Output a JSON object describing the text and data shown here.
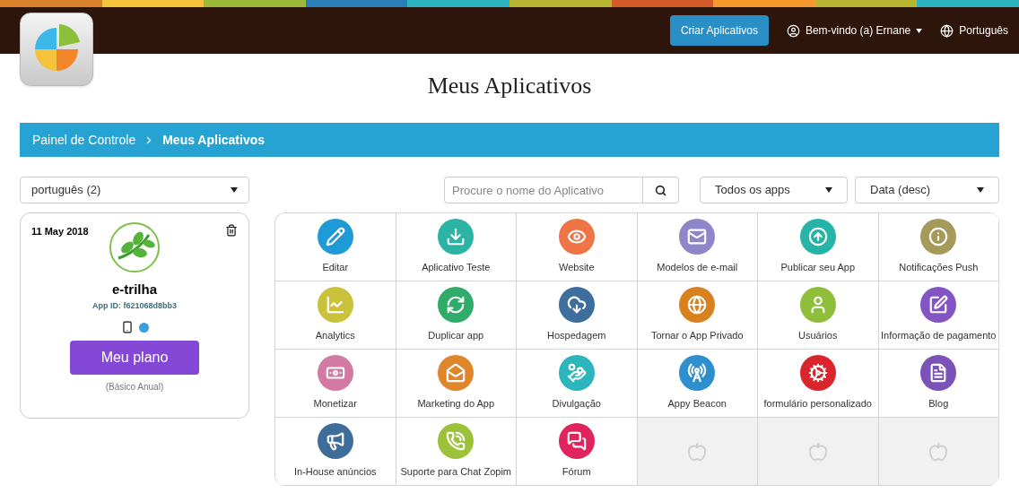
{
  "topbar": {
    "create_button": "Criar Aplicativos",
    "user_menu": "Bem-vindo (a) Ernane",
    "language": "Português"
  },
  "title": "Meus Aplicativos",
  "breadcrumb": [
    "Painel de Controle",
    "Meus Aplicativos"
  ],
  "filters": {
    "language_select": "português (2)",
    "search": {
      "placeholder": "Procure o nome do Aplicativo"
    },
    "type_select": "Todos os apps",
    "sort_select": "Data (desc)"
  },
  "app_card": {
    "date": "11 May 2018",
    "name": "e-trilha",
    "app_id": "App ID: f621068d8bb3",
    "plan_button": "Meu plano",
    "plan_note": "(Básico Anual)"
  },
  "tiles": [
    {
      "kind": "feature",
      "label": "Editar",
      "color": "#1e9ad6"
    },
    {
      "kind": "feature",
      "label": "Aplicativo Teste",
      "color": "#2bb3a3"
    },
    {
      "kind": "feature",
      "label": "Website",
      "color": "#ef7446"
    },
    {
      "kind": "feature",
      "label": "Modelos de e-mail",
      "color": "#8e86c9"
    },
    {
      "kind": "feature",
      "label": "Publicar seu App",
      "color": "#27b4a8"
    },
    {
      "kind": "feature",
      "label": "Notificações Push",
      "color": "#a59a5a"
    },
    {
      "kind": "feature",
      "label": "Analytics",
      "color": "#c9c23a"
    },
    {
      "kind": "feature",
      "label": "Duplicar app",
      "color": "#2fab6a"
    },
    {
      "kind": "feature",
      "label": "Hospedagem",
      "color": "#3d6e9e"
    },
    {
      "kind": "feature",
      "label": "Tornar o App Privado",
      "color": "#d9801f"
    },
    {
      "kind": "feature",
      "label": "Usuários",
      "color": "#8fbf3a"
    },
    {
      "kind": "feature",
      "label": "Informação de pagamento",
      "color": "#8355c4"
    },
    {
      "kind": "feature",
      "label": "Monetizar",
      "color": "#d27aa3"
    },
    {
      "kind": "feature",
      "label": "Marketing do App",
      "color": "#e0862a"
    },
    {
      "kind": "feature",
      "label": "Divulgação",
      "color": "#2cb5bc"
    },
    {
      "kind": "feature",
      "label": "Appy Beacon",
      "color": "#2e8fcf"
    },
    {
      "kind": "feature",
      "label": "formulário personalizado",
      "color": "#d9252b"
    },
    {
      "kind": "feature",
      "label": "Blog",
      "color": "#7a52b8"
    },
    {
      "kind": "feature",
      "label": "In-House anúncios",
      "color": "#3f6d99"
    },
    {
      "kind": "feature",
      "label": "Suporte para Chat Zopim",
      "color": "#9cc23a"
    },
    {
      "kind": "feature",
      "label": "Fórum",
      "color": "#e0245e"
    },
    {
      "kind": "empty"
    },
    {
      "kind": "empty"
    },
    {
      "kind": "empty"
    }
  ]
}
